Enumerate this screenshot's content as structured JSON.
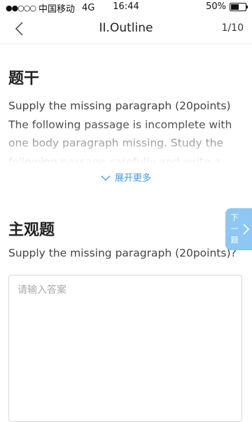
{
  "status_bar": {
    "signal": "●●○○○",
    "carrier": "中国移动",
    "network": "4G",
    "time": "16:44",
    "battery_text": "50%",
    "battery_level": 0.5
  },
  "nav": {
    "back_icon": "chevron-left-icon",
    "title": "II.Outline",
    "counter": "1/10"
  },
  "stem": {
    "heading": "题干",
    "text": "Supply the missing paragraph (20points) The following passage is incomplete with one body paragraph missing. Study the following passage carefully and write a paragraph of",
    "expand_label": "展开更多",
    "expand_icon": "chevron-down-icon"
  },
  "subjective": {
    "heading": "主观题",
    "question": "Supply the missing paragraph (20points)?",
    "answer_value": "",
    "answer_placeholder": "请输入答案"
  },
  "next_tab": {
    "label_line1": "下",
    "label_line2": "一",
    "label_line3": "题",
    "icon": "chevron-right-icon"
  },
  "colors": {
    "accent": "#3d9be9",
    "next_tab_bg": "#8ec7f3"
  }
}
